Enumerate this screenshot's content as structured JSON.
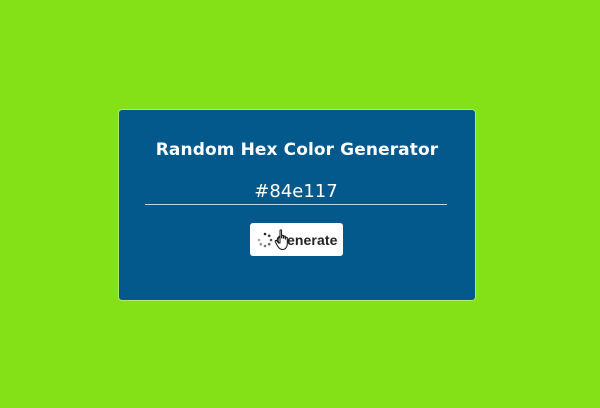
{
  "colors": {
    "background": "#84e117",
    "card": "#03588c",
    "text": "#ffffff",
    "button_bg": "#ffffff"
  },
  "app": {
    "title": "Random Hex Color Generator",
    "hex_value": "#84e117",
    "button_label": "Generate"
  },
  "icons": {
    "loading": "spinner-icon",
    "pointer": "hand-cursor-icon"
  }
}
